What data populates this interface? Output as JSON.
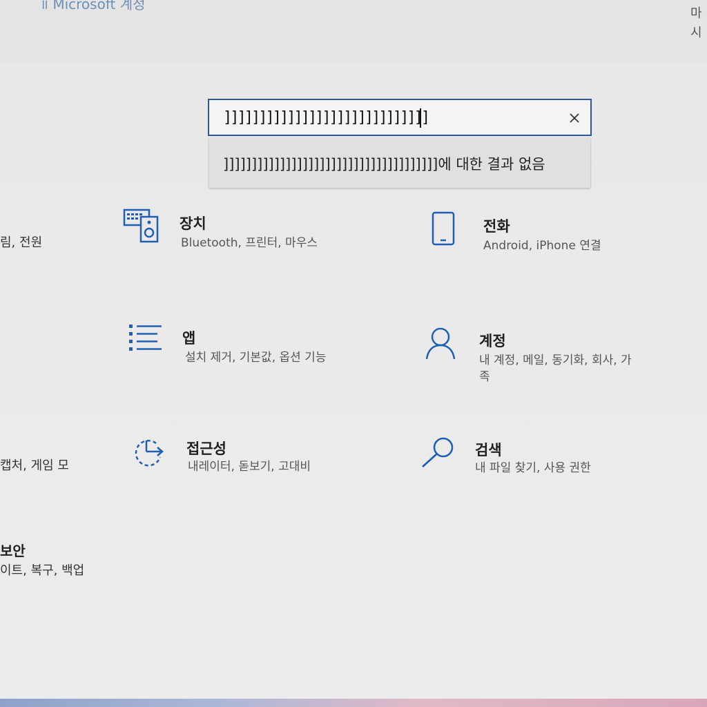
{
  "window": {
    "title_fragment": "॥ Microsoft 계정",
    "right_edge": [
      "마",
      "시"
    ]
  },
  "search": {
    "value": "]]]]]]]]]]]]]]]]]]]]]]]]]]]]]]]]]]]]",
    "clear_icon": "close-icon"
  },
  "suggestion": {
    "text": "]]]]]]]]]]]]]]]]]]]]]]]]]]]]]]]]]]]]]]에 대한 결과 없음"
  },
  "left_column": [
    {
      "text": "림, 전원",
      "is_title": false
    },
    {
      "text": "캡처, 게임 모",
      "is_title": false
    },
    {
      "text": "보안",
      "is_title": true
    },
    {
      "text": "이트, 복구, 백업",
      "is_title": false
    }
  ],
  "tiles": [
    {
      "id": "devices",
      "icon": "keyboard-speaker-icon",
      "title": "장치",
      "desc": [
        "Bluetooth, 프린터, 마우스"
      ]
    },
    {
      "id": "phone",
      "icon": "phone-icon",
      "title": "전화",
      "desc": [
        "Android, iPhone 연결"
      ]
    },
    {
      "id": "apps",
      "icon": "apps-list-icon",
      "title": "앱",
      "desc": [
        "설치 제거, 기본값, 옵션 기능"
      ]
    },
    {
      "id": "accounts",
      "icon": "person-icon",
      "title": "계정",
      "desc": [
        "내 계정, 메일, 동기화, 회사, 가",
        "족"
      ]
    },
    {
      "id": "accessibility",
      "icon": "accessibility-timer-icon",
      "title": "접근성",
      "desc": [
        "내레이터, 돋보기, 고대비"
      ]
    },
    {
      "id": "search",
      "icon": "search-icon",
      "title": "검색",
      "desc": [
        "내 파일 찾기, 사용 권한"
      ]
    }
  ],
  "colors": {
    "accent": "#1f5fb3",
    "icon": "#1f5fb3",
    "search_border": "#2a56a8"
  }
}
